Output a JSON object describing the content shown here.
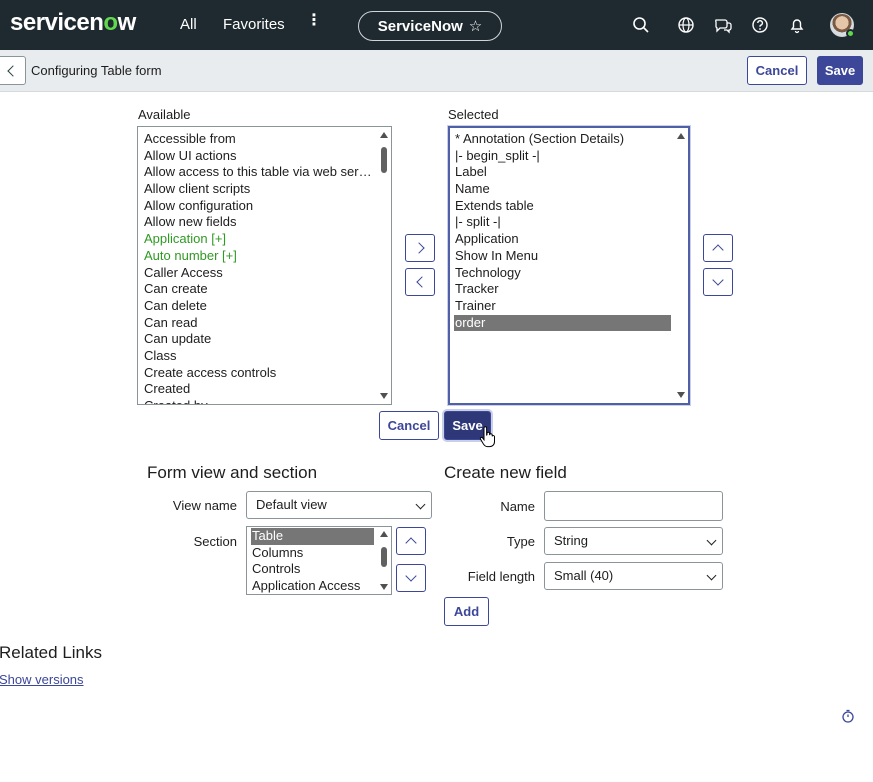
{
  "topnav": {
    "logo_text_a": "servicen",
    "logo_text_o": "o",
    "logo_text_b": "w",
    "all": "All",
    "favorites": "Favorites",
    "more": "⋮",
    "instance_pill": "ServiceNow",
    "star": "☆",
    "icons": [
      "search-icon",
      "globe-icon",
      "chat-icon",
      "help-icon",
      "bell-icon",
      "avatar"
    ],
    "accent_color": "#62d84e",
    "bg_color": "#1f2a30"
  },
  "subheader": {
    "back": "<",
    "title": "Configuring Table form",
    "cancel": "Cancel",
    "save": "Save"
  },
  "slushbucket": {
    "available_label": "Available",
    "selected_label": "Selected",
    "available_items": [
      {
        "text": "Accessible from",
        "style": "normal"
      },
      {
        "text": "Allow UI actions",
        "style": "normal"
      },
      {
        "text": "Allow access to this table via web services",
        "style": "normal"
      },
      {
        "text": "Allow client scripts",
        "style": "normal"
      },
      {
        "text": "Allow configuration",
        "style": "normal"
      },
      {
        "text": "Allow new fields",
        "style": "normal"
      },
      {
        "text": "Application [+]",
        "style": "green"
      },
      {
        "text": "Auto number [+]",
        "style": "green"
      },
      {
        "text": "Caller Access",
        "style": "normal"
      },
      {
        "text": "Can create",
        "style": "normal"
      },
      {
        "text": "Can delete",
        "style": "normal"
      },
      {
        "text": "Can read",
        "style": "normal"
      },
      {
        "text": "Can update",
        "style": "normal"
      },
      {
        "text": "Class",
        "style": "normal"
      },
      {
        "text": "Create access controls",
        "style": "normal"
      },
      {
        "text": "Created",
        "style": "normal"
      },
      {
        "text": "Created by",
        "style": "normal"
      }
    ],
    "selected_items": [
      {
        "text": "* Annotation (Section Details)",
        "style": "normal"
      },
      {
        "text": "|- begin_split -|",
        "style": "normal"
      },
      {
        "text": "Label",
        "style": "normal"
      },
      {
        "text": "Name",
        "style": "normal"
      },
      {
        "text": "Extends table",
        "style": "normal"
      },
      {
        "text": "|- split -|",
        "style": "normal"
      },
      {
        "text": "Application",
        "style": "normal"
      },
      {
        "text": "Show In Menu",
        "style": "normal"
      },
      {
        "text": "Technology",
        "style": "normal"
      },
      {
        "text": "Tracker",
        "style": "normal"
      },
      {
        "text": "Trainer",
        "style": "normal"
      },
      {
        "text": "order",
        "style": "selected"
      }
    ],
    "cancel": "Cancel",
    "save": "Save"
  },
  "form_view": {
    "heading": "Form view and section",
    "view_name_label": "View name",
    "view_name_value": "Default view",
    "section_label": "Section",
    "sections": [
      {
        "text": "Table",
        "style": "selected"
      },
      {
        "text": "Columns",
        "style": "normal"
      },
      {
        "text": "Controls",
        "style": "normal"
      },
      {
        "text": "Application Access",
        "style": "normal"
      }
    ]
  },
  "new_field": {
    "heading": "Create new field",
    "name_label": "Name",
    "name_value": "",
    "type_label": "Type",
    "type_value": "String",
    "length_label": "Field length",
    "length_value": "Small (40)",
    "add": "Add"
  },
  "related": {
    "heading": "Related Links",
    "show_versions": "Show versions"
  },
  "colors": {
    "primary": "#3c4799",
    "selected_row": "#767676",
    "green_text": "#2f9a23"
  }
}
